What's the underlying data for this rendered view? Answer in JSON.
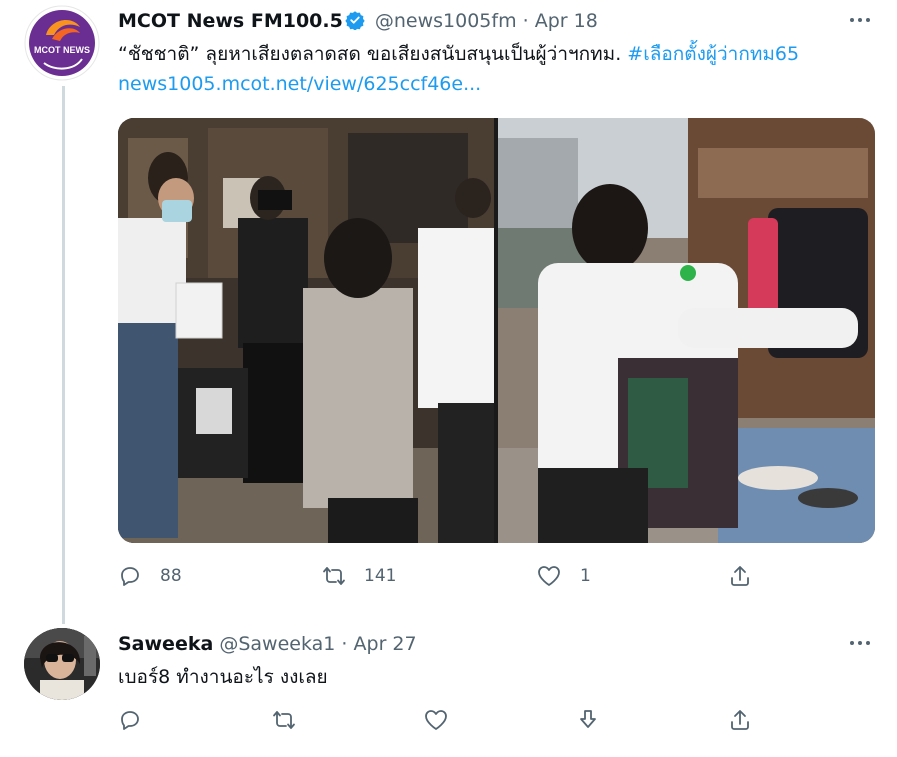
{
  "tweet": {
    "author_name": "MCOT News FM100.5",
    "handle": "@news1005fm",
    "separator": "·",
    "date": "Apr 18",
    "text": "“ชัชชาติ” ลุยหาเสียงตลาดสด ขอเสียงสนับสนุนเป็นผู้ว่าฯกทม.",
    "hashtag": "#เลือกตั้งผู้ว่ากทม65",
    "link": "news1005.mcot.net/view/625ccf46e...",
    "avatar_logo_text": "MCOT NEWS",
    "replies": "88",
    "retweets": "141",
    "likes": "1",
    "icons": [
      "verified-badge-icon",
      "more-icon",
      "reply-icon",
      "retweet-icon",
      "like-icon",
      "share-icon"
    ],
    "colors": {
      "verified": "#1d9bf0",
      "link": "#1d9bf0",
      "muted": "#536471",
      "thread": "#cfd9de"
    }
  },
  "reply": {
    "author_name": "Saweeka",
    "handle": "@Saweeka1",
    "separator": "·",
    "date": "Apr 27",
    "text": "เบอร์8 ทำงานอะไร งงเลย",
    "icons": [
      "more-icon",
      "reply-icon",
      "retweet-icon",
      "like-icon",
      "download-icon",
      "share-icon"
    ]
  }
}
